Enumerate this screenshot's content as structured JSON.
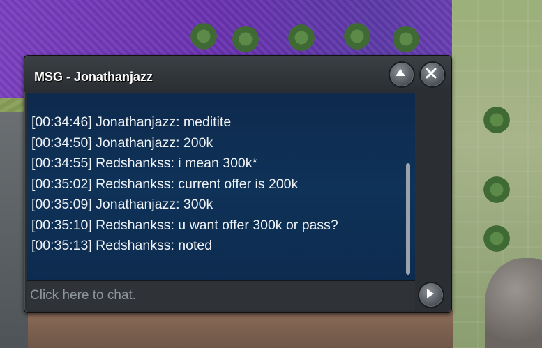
{
  "window": {
    "title": "MSG - Jonathanjazz",
    "minimize_icon": "chevron-up-icon",
    "close_icon": "close-icon"
  },
  "messages": [
    "[00:34:46] Jonathanjazz: meditite",
    "[00:34:50] Jonathanjazz: 200k",
    "[00:34:55] Redshankss: i mean 300k*",
    "[00:35:02] Redshankss: current offer is 200k",
    "[00:35:09] Jonathanjazz: 300k",
    "[00:35:10] Redshankss: u want offer 300k or pass?",
    "[00:35:13] Redshankss: noted"
  ],
  "input": {
    "placeholder": "Click here to chat."
  },
  "send_icon": "send-arrow-icon",
  "colors": {
    "message_pane": "#0f3258",
    "message_text": "#eef2f6",
    "frame": "#2b2f33"
  }
}
